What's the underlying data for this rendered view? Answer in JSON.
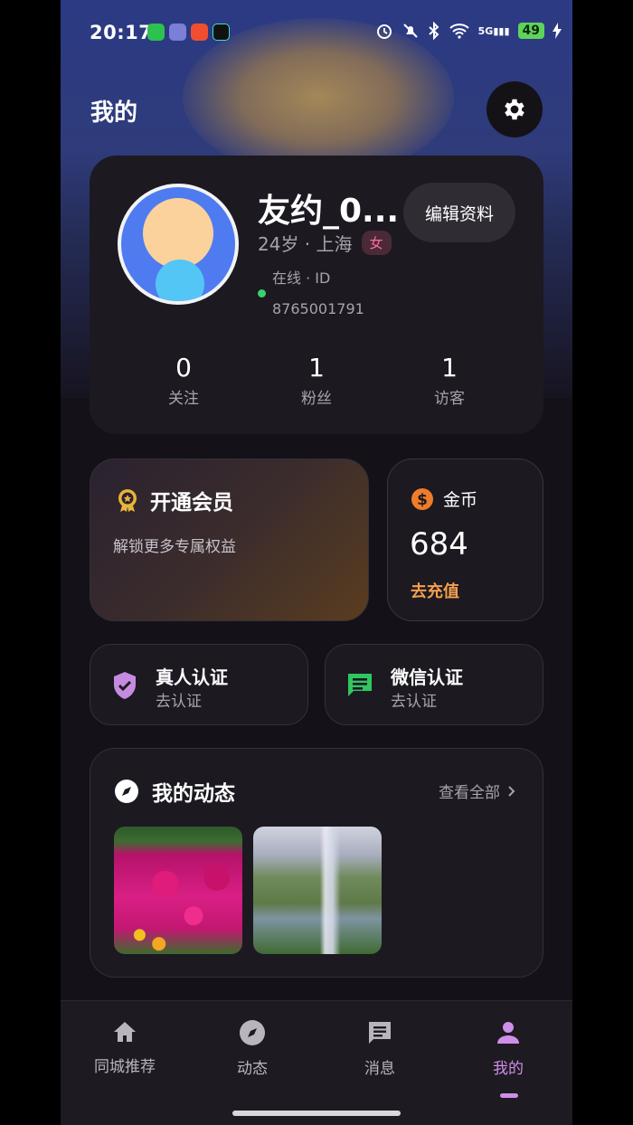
{
  "status_bar": {
    "time": "20:17",
    "app_icons": [
      "wechat-icon",
      "game-icon",
      "app-icon",
      "douyin-icon"
    ],
    "signal_label": "5G",
    "battery": "49"
  },
  "header": {
    "title": "我的"
  },
  "profile": {
    "nickname": "友约_0...",
    "edit_label": "编辑资料",
    "meta": "24岁 · 上海",
    "gender": "女",
    "online_text": "在线 · ID",
    "user_id": "8765001791",
    "stats": [
      {
        "value": "0",
        "label": "关注"
      },
      {
        "value": "1",
        "label": "粉丝"
      },
      {
        "value": "1",
        "label": "访客"
      }
    ]
  },
  "vip": {
    "title": "开通会员",
    "desc": "解锁更多专属权益"
  },
  "coins": {
    "title": "金币",
    "amount": "684",
    "action": "去充值"
  },
  "verify": {
    "real": {
      "title": "真人认证",
      "action": "去认证"
    },
    "wechat": {
      "title": "微信认证",
      "action": "去认证"
    }
  },
  "moments": {
    "title": "我的动态",
    "see_all": "查看全部"
  },
  "tabs": [
    {
      "label": "同城推荐",
      "icon": "home-icon"
    },
    {
      "label": "动态",
      "icon": "compass-icon"
    },
    {
      "label": "消息",
      "icon": "message-icon"
    },
    {
      "label": "我的",
      "icon": "person-icon",
      "active": true
    }
  ],
  "colors": {
    "accent": "#cf8ee8",
    "coin_orange": "#f3a04d",
    "online_green": "#38d16b",
    "gender_pink": "#ff6d9c"
  }
}
